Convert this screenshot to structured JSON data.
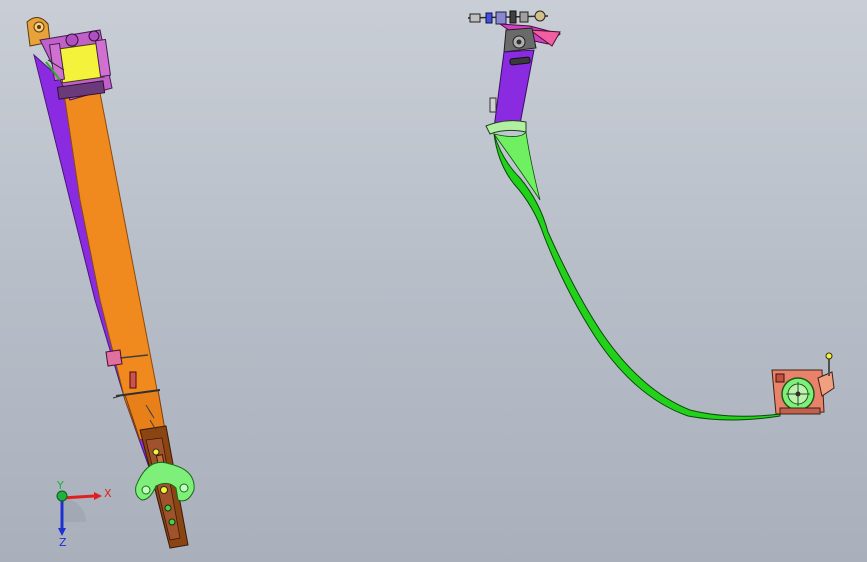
{
  "triad": {
    "x_label": "X",
    "y_label": "Y",
    "z_label": "Z",
    "x_color": "#e02020",
    "y_color": "#20b040",
    "z_color": "#2030d0"
  },
  "colors": {
    "background_top": "#c9ced6",
    "background_bottom": "#a9b0bc",
    "pillar_orange": "#f0891e",
    "pillar_purple": "#8a2be2",
    "webbing_green": "#22d11a",
    "retractor_yellow": "#f4f23a",
    "bracket_magenta": "#c040c0",
    "buckle_brown": "#8b4513",
    "anchor_salmon": "#e8826a"
  },
  "icons": {
    "view_triad": "axis-triad-icon"
  }
}
